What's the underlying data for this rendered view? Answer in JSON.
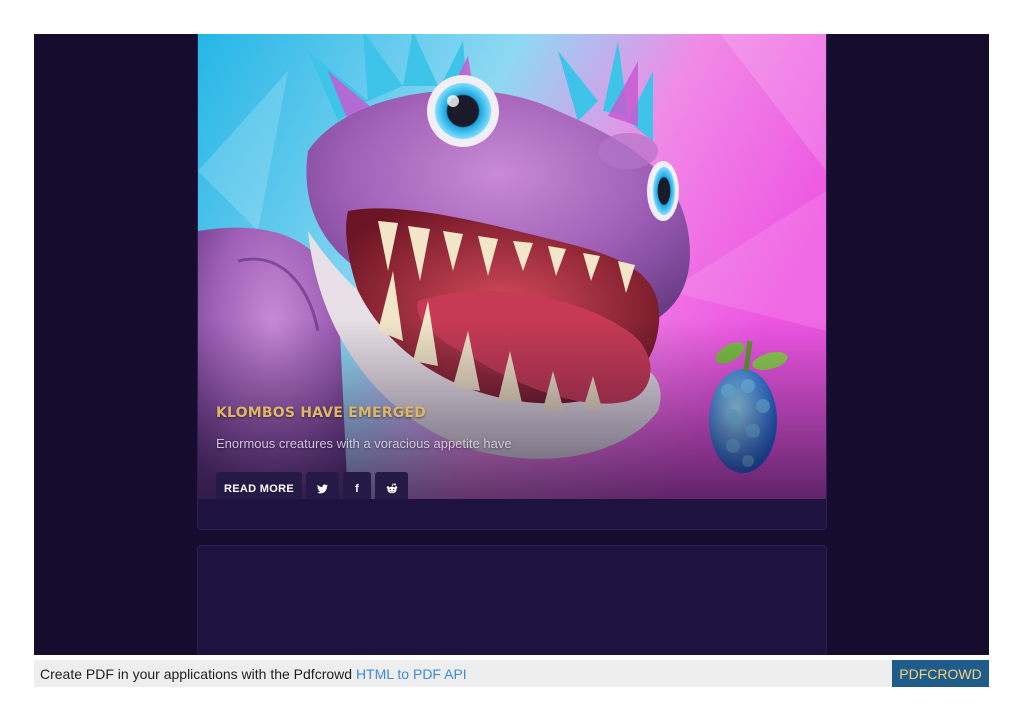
{
  "article": {
    "title": "KLOMBOS HAVE EMERGED",
    "excerpt": "Enormous creatures with a voracious appetite have",
    "read_more_label": "READ MORE",
    "share": [
      {
        "icon": "twitter-icon",
        "glyph": "🐦"
      },
      {
        "icon": "facebook-icon",
        "glyph": "f"
      },
      {
        "icon": "reddit-icon",
        "glyph": "👽"
      }
    ]
  },
  "colors": {
    "page_bg": "#150c2e",
    "card_bg": "#1e1340",
    "headline": "#e0b765",
    "button_bg": "#241a45"
  },
  "footer": {
    "text": "Create PDF in your applications with the Pdfcrowd",
    "link_label": "HTML to PDF API",
    "badge_label": "PDFCROWD"
  }
}
